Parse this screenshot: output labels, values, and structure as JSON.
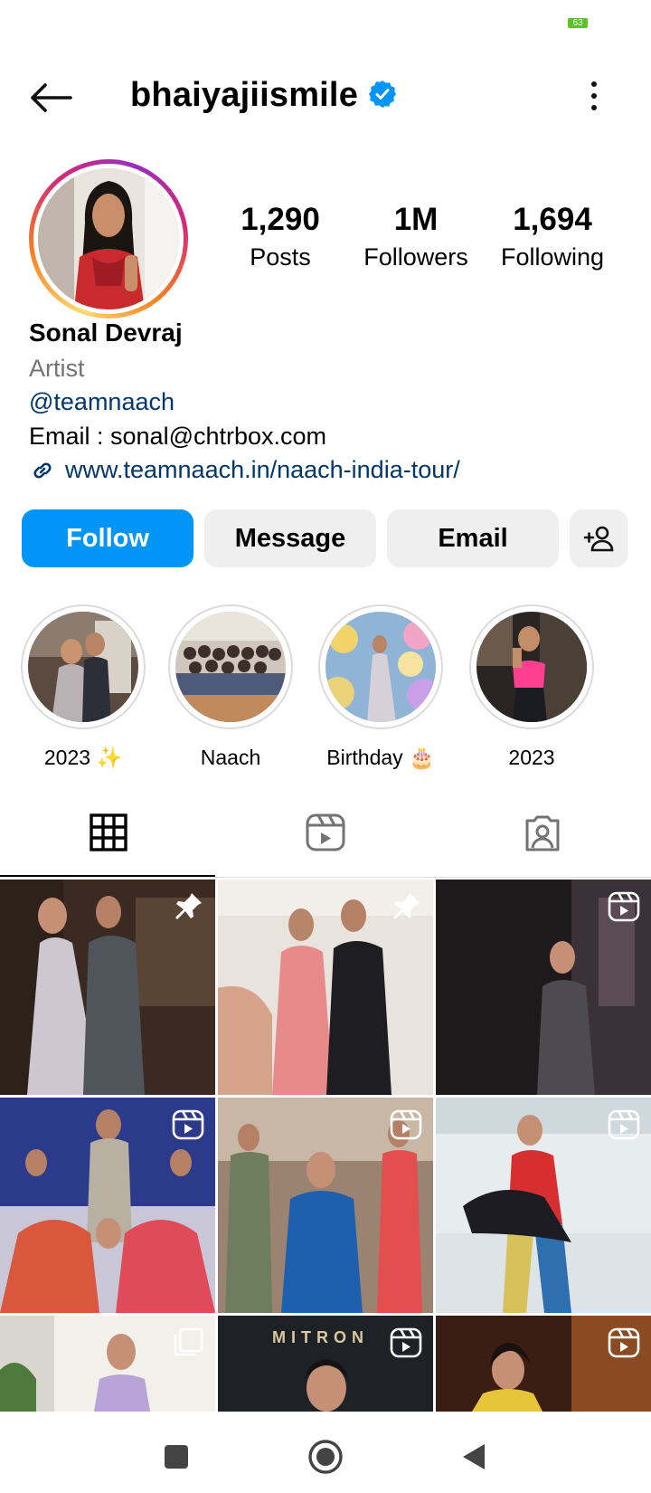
{
  "status_bar": {
    "battery": "63"
  },
  "header": {
    "username": "bhaiyajiismile"
  },
  "profile": {
    "stats": [
      {
        "value": "1,290",
        "label": "Posts"
      },
      {
        "value": "1M",
        "label": "Followers"
      },
      {
        "value": "1,694",
        "label": "Following"
      }
    ],
    "name": "Sonal Devraj",
    "category": "Artist",
    "mention": "@teamnaach",
    "email_line": "Email : sonal@chtrbox.com",
    "link": "www.teamnaach.in/naach-india-tour/"
  },
  "actions": {
    "follow": "Follow",
    "message": "Message",
    "email": "Email"
  },
  "highlights": [
    {
      "label": "2023 ✨"
    },
    {
      "label": "Naach"
    },
    {
      "label": "Birthday 🎂"
    },
    {
      "label": "2023"
    }
  ],
  "tabs": [
    {
      "icon": "grid-icon"
    },
    {
      "icon": "reels-icon"
    },
    {
      "icon": "tagged-icon"
    }
  ],
  "grid": {
    "badges": [
      "pin",
      "pin",
      "reel",
      "reel",
      "reel",
      "reel",
      "carousel",
      "reel",
      "reel"
    ],
    "overlay_text": "MITRON"
  },
  "colors": {
    "follow_button": "#0095f6",
    "link": "#00376b",
    "verified": "#0095f6",
    "secondary_text": "#737373"
  }
}
